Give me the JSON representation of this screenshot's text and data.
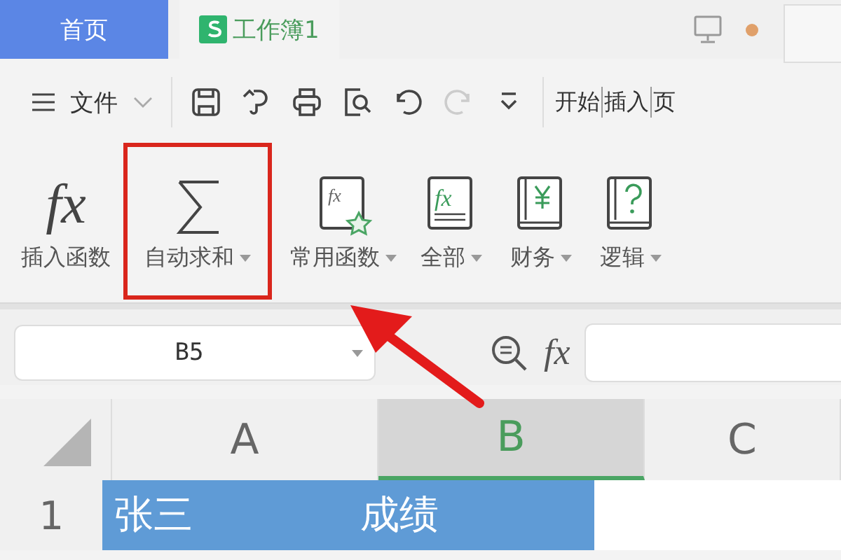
{
  "tabs": [
    {
      "label": "首页",
      "kind": "home",
      "selected": false
    },
    {
      "label": "工作簿1",
      "kind": "document",
      "selected": true
    }
  ],
  "toolbar": {
    "file_menu": "文件",
    "quick_actions": [
      {
        "kind": "save",
        "disabled": false
      },
      {
        "kind": "format",
        "disabled": false
      },
      {
        "kind": "print",
        "disabled": false
      },
      {
        "kind": "preview",
        "disabled": false
      },
      {
        "kind": "undo",
        "disabled": false
      },
      {
        "kind": "redo",
        "disabled": true
      },
      {
        "kind": "more",
        "disabled": false
      }
    ],
    "ribbon_tabs": [
      {
        "label": "开始"
      },
      {
        "label": "插入"
      },
      {
        "label": "页"
      }
    ]
  },
  "functions": [
    {
      "label": "插入函数",
      "kind": "fx",
      "icon_text": "fx",
      "dropdown": false,
      "highlighted": false
    },
    {
      "label": "自动求和",
      "kind": "sum",
      "dropdown": true,
      "highlighted": true
    },
    {
      "label": "常用函数",
      "kind": "common",
      "icon_text": "fx",
      "dropdown": true,
      "highlighted": false
    },
    {
      "label": "全部",
      "kind": "all",
      "icon_text": "fx",
      "dropdown": true,
      "highlighted": false
    },
    {
      "label": "财务",
      "kind": "finance",
      "dropdown": true,
      "highlighted": false
    },
    {
      "label": "逻辑",
      "kind": "logic",
      "dropdown": true,
      "highlighted": false
    }
  ],
  "formula_bar": {
    "name_box": "B5",
    "function_button": "fx"
  },
  "sheet": {
    "columns": [
      {
        "label": "A",
        "selected": false
      },
      {
        "label": "B",
        "selected": true
      },
      {
        "label": "C",
        "selected": false
      }
    ],
    "rows": [
      {
        "label": "1",
        "cells": [
          {
            "text": "张三",
            "selected": true
          },
          {
            "text": "成绩",
            "selected": true
          },
          {
            "selected": false
          }
        ]
      }
    ]
  }
}
